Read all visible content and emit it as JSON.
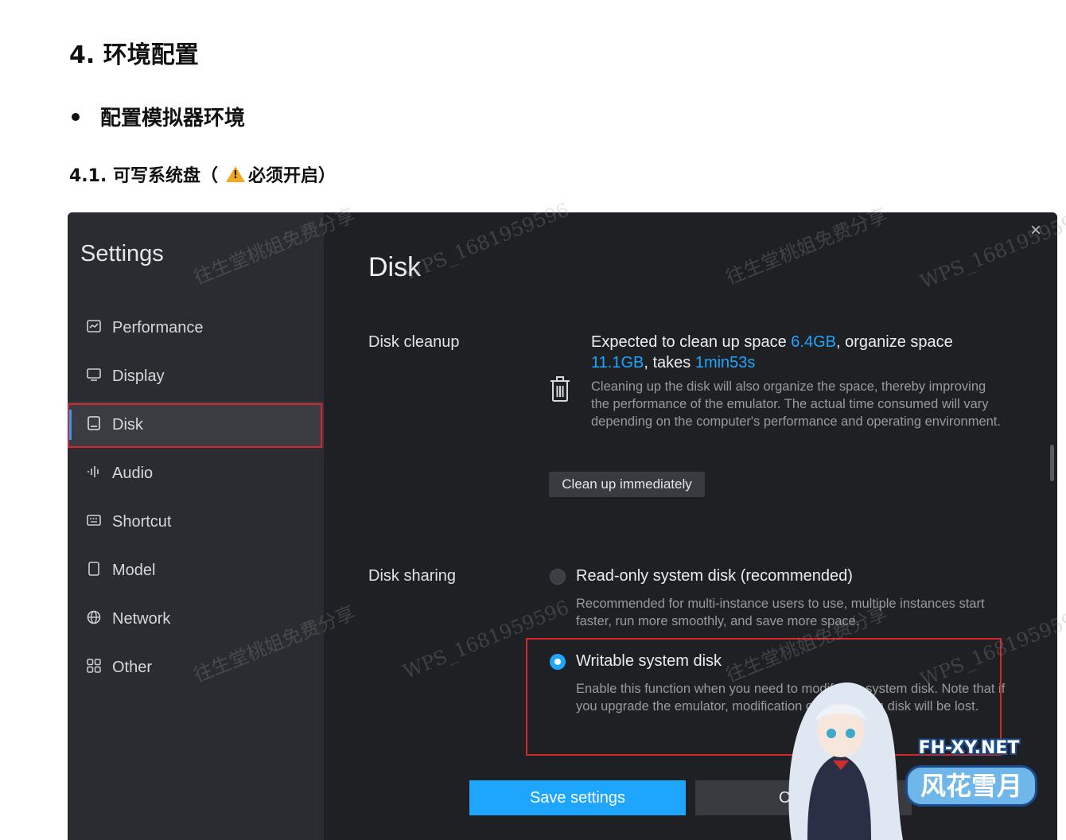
{
  "doc": {
    "heading": "4. 环境配置",
    "bullet": "配置模拟器环境",
    "subheading_prefix": "4.1. 可写系统盘（",
    "subheading_suffix": "必须开启）"
  },
  "settings": {
    "sidebar": {
      "title": "Settings",
      "items": [
        {
          "label": "Performance",
          "icon": "performance-icon"
        },
        {
          "label": "Display",
          "icon": "display-icon"
        },
        {
          "label": "Disk",
          "icon": "disk-icon"
        },
        {
          "label": "Audio",
          "icon": "audio-icon"
        },
        {
          "label": "Shortcut",
          "icon": "keyboard-icon"
        },
        {
          "label": "Model",
          "icon": "phone-icon"
        },
        {
          "label": "Network",
          "icon": "globe-icon"
        },
        {
          "label": "Other",
          "icon": "grid-icon"
        }
      ],
      "active": "Disk"
    },
    "main": {
      "title": "Disk",
      "cleanup": {
        "label": "Disk cleanup",
        "line_a": "Expected to clean up space ",
        "space_value": "6.4GB",
        "line_b": ", organize space ",
        "organize_value": "11.1GB",
        "line_c": ", takes ",
        "time_value": "1min53s",
        "description": "Cleaning up the disk will also organize the space, thereby improving the performance of the emulator. The actual time consumed will vary depending on the computer's performance and operating environment.",
        "button": "Clean up immediately"
      },
      "sharing": {
        "label": "Disk sharing",
        "options": [
          {
            "title": "Read-only system disk (recommended)",
            "description": "Recommended for multi-instance users to use, multiple instances start faster, run more smoothly, and save more space.",
            "selected": false
          },
          {
            "title": "Writable system disk",
            "description": "Enable this function when you need to modify the system disk. Note that if you upgrade the emulator, modification of the system disk will be lost.",
            "selected": true
          }
        ]
      },
      "save_button": "Save settings",
      "cancel_button": "Cancel"
    }
  },
  "watermarks": {
    "cn": "往生堂桃姐免费分享",
    "id": "WPS_1681959596"
  },
  "logo": {
    "domain": "FH-XY.NET",
    "name": "风花雪月"
  },
  "colors": {
    "accent": "#1ea6ff",
    "highlight_box": "#d6262c",
    "warning": "#f5a623"
  }
}
